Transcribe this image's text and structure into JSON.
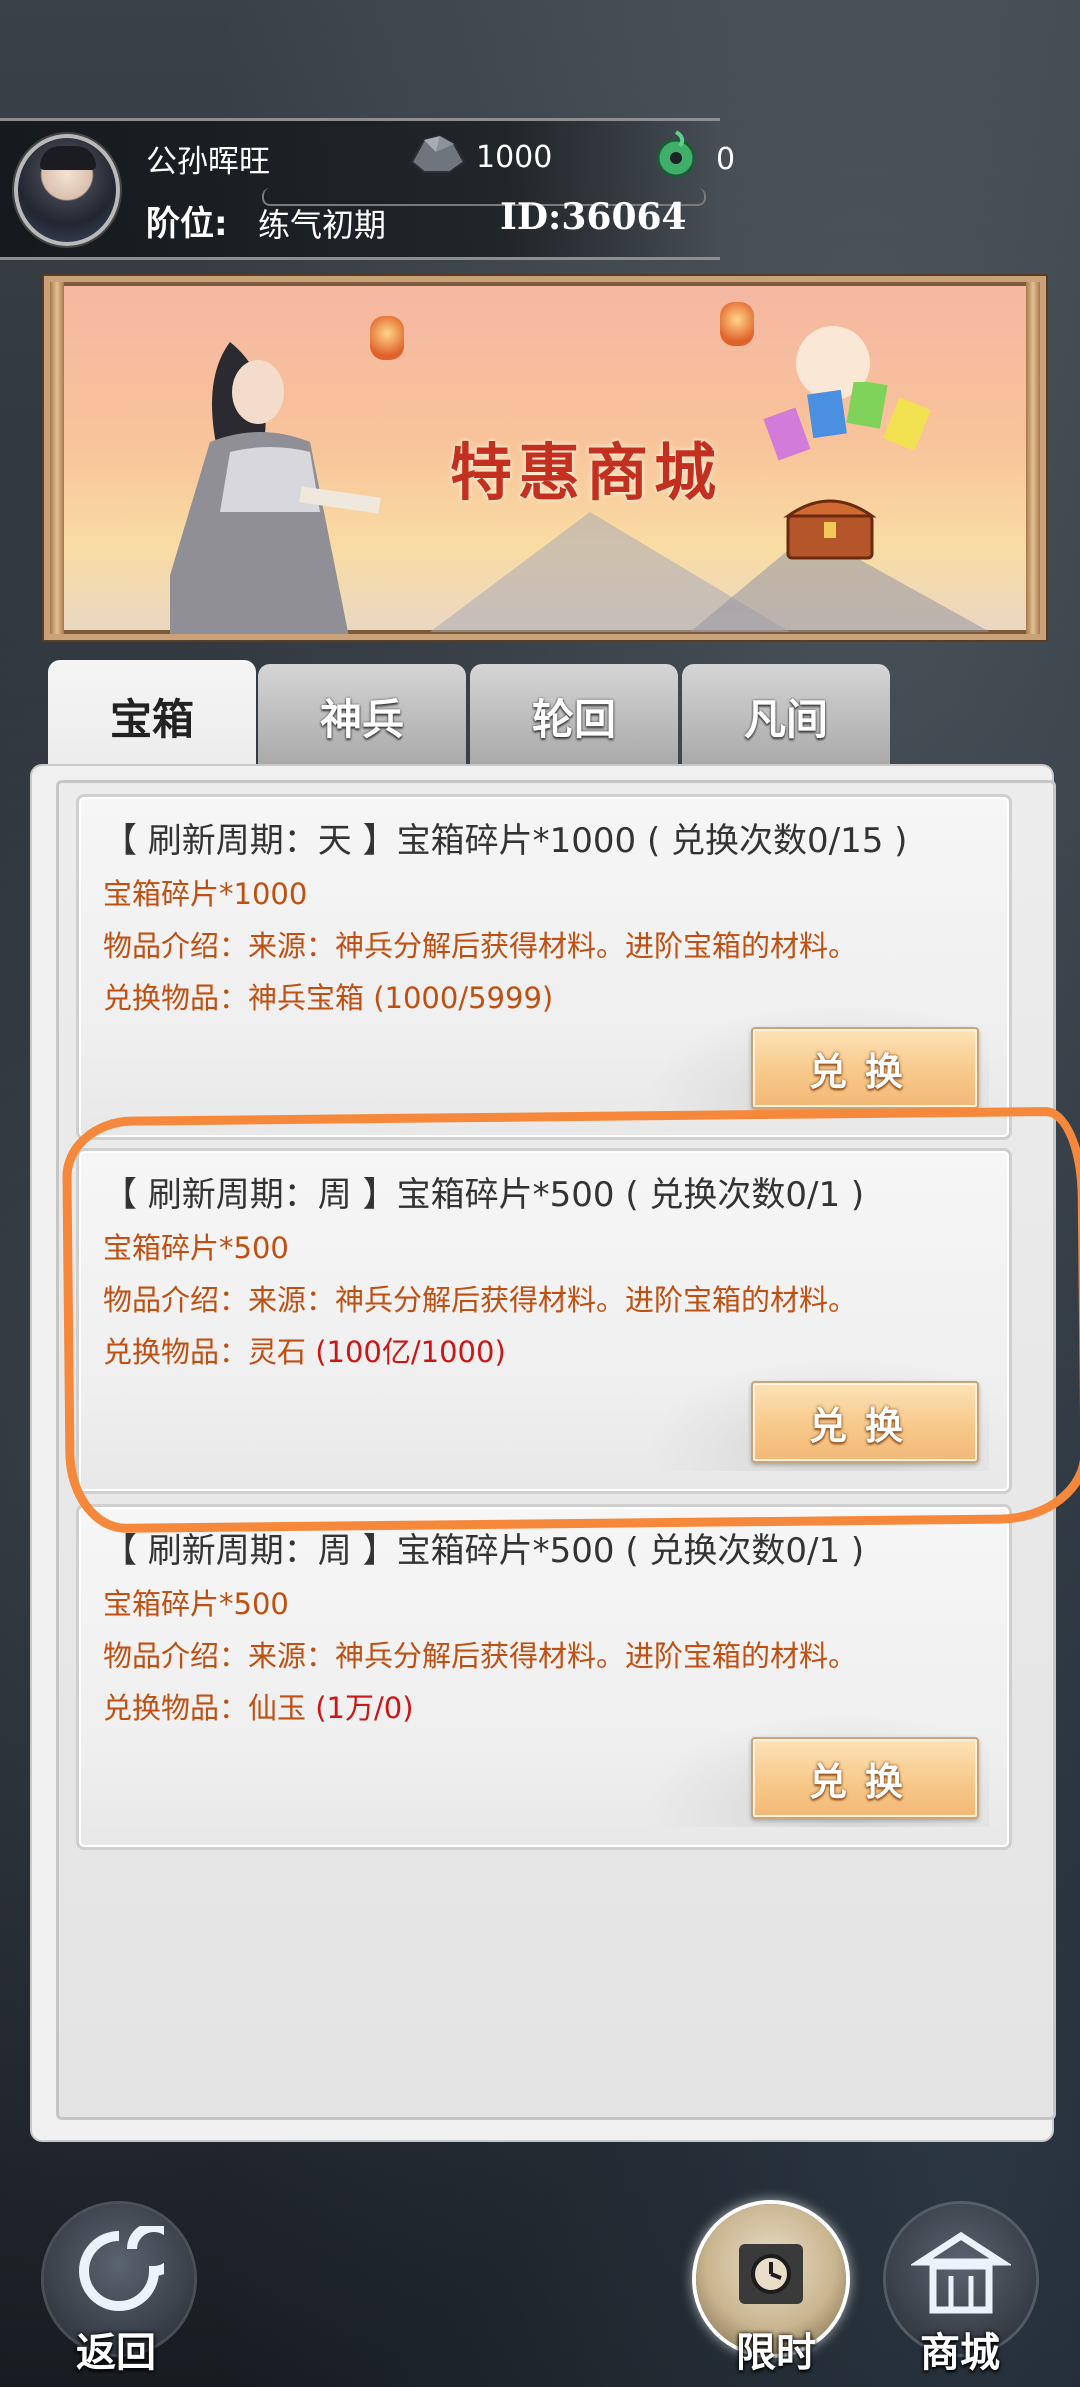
{
  "player": {
    "name": "公孙晖旺",
    "rank_label": "阶位:",
    "rank_value": "练气初期",
    "id_text": "ID:36064",
    "ore_amount": "1000",
    "jade_amount": "0"
  },
  "banner": {
    "title": "特惠商城"
  },
  "tabs": [
    {
      "label": "宝箱",
      "active": true
    },
    {
      "label": "神兵",
      "active": false
    },
    {
      "label": "轮回",
      "active": false
    },
    {
      "label": "凡间",
      "active": false
    }
  ],
  "items": [
    {
      "title": "【 刷新周期：天 】宝箱碎片*1000 ( 兑换次数0/15 )",
      "cost": "宝箱碎片*1000",
      "desc": "物品介绍：来源：神兵分解后获得材料。进阶宝箱的材料。",
      "reward_prefix": "兑换物品：神兵宝箱 ",
      "reward_value": "(1000/5999)",
      "reward_value_red": false,
      "button": "兑换"
    },
    {
      "title": "【 刷新周期：周 】宝箱碎片*500 ( 兑换次数0/1 )",
      "cost": "宝箱碎片*500",
      "desc": "物品介绍：来源：神兵分解后获得材料。进阶宝箱的材料。",
      "reward_prefix": "兑换物品：灵石 ",
      "reward_value": "(100亿/1000)",
      "reward_value_red": true,
      "button": "兑换"
    },
    {
      "title": "【 刷新周期：周 】宝箱碎片*500 ( 兑换次数0/1 )",
      "cost": "宝箱碎片*500",
      "desc": "物品介绍：来源：神兵分解后获得材料。进阶宝箱的材料。",
      "reward_prefix": "兑换物品：仙玉 ",
      "reward_value": "(1万/0)",
      "reward_value_red": true,
      "button": "兑换"
    }
  ],
  "nav": {
    "back": "返回",
    "limited": "限时",
    "shop": "商城"
  },
  "colors": {
    "highlight_stroke": "#f5883a",
    "item_text": "#c05012",
    "item_red": "#cc1616",
    "button_fill": "#f7c98a"
  }
}
